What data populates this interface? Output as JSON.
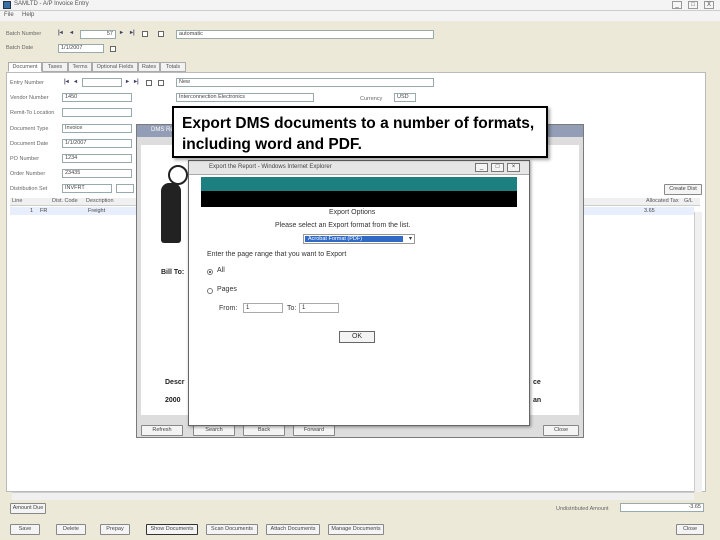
{
  "window": {
    "title": "SAMLTD - A/P Invoice Entry",
    "menu": [
      "File",
      "Help"
    ],
    "controls": [
      "_",
      "□",
      "X"
    ]
  },
  "header": {
    "batch_number_label": "Batch Number",
    "batch_number_value": "57",
    "batch_desc_value": "automatic",
    "batch_date_label": "Batch Date",
    "batch_date_value": "1/1/2007"
  },
  "tabs": [
    "Document",
    "Taxes",
    "Terms",
    "Optional Fields",
    "Rates",
    "Totals"
  ],
  "form": {
    "entry_number_label": "Entry Number",
    "entry_number_value": "",
    "entry_desc_value": "New",
    "vendor_number_label": "Vendor Number",
    "vendor_number_value": "1450",
    "vendor_name_value": "Interconnection Electronics",
    "currency_label": "Currency",
    "currency_value": "USD",
    "remit_to_label": "Remit-To Location",
    "document_type_label": "Document Type",
    "document_type_value": "Invoice",
    "document_date_label": "Document Date",
    "document_date_value": "1/1/2007",
    "po_number_label": "PO Number",
    "po_number_value": "1234",
    "order_number_label": "Order Number",
    "order_number_value": "23435",
    "dist_set_label": "Distribution Set",
    "dist_set_value": "INVFRT"
  },
  "grid": {
    "columns": [
      "Line",
      "Dist. Code",
      "Description",
      "Allocated Tax",
      "G/L"
    ],
    "rows": [
      {
        "line": "1",
        "code": "FR",
        "desc": "Freight",
        "tax": "3.65"
      }
    ],
    "create_dist_label": "Create Dist"
  },
  "viewer": {
    "title": "DMS Report",
    "bill_to": "Bill To:",
    "desc_header": "Descr",
    "desc_value": "2000",
    "right_header": "ce",
    "right_value": "an",
    "buttons": [
      "Refresh",
      "Search",
      "Back",
      "Forward",
      "Close"
    ]
  },
  "dialog": {
    "title": "Export the Report - Windows Internet Explorer",
    "heading": "Export Options",
    "prompt": "Please select an Export format from the list.",
    "format_value": "Acrobat Format (PDF)",
    "range_prompt": "Enter the page range that you want to Export",
    "option_all": "All",
    "option_pages": "Pages",
    "from_label": "From:",
    "from_value": "1",
    "to_label": "To:",
    "to_value": "1",
    "ok_label": "OK"
  },
  "footer": {
    "amount_due_label": "Amount Due",
    "undistributed_label": "Undistributed Amount",
    "undistributed_value": "-3.65",
    "buttons": [
      "Save",
      "Delete",
      "Prepay",
      "Show Documents",
      "Scan Documents",
      "Attach Documents",
      "Manage Documents"
    ],
    "close_label": "Close"
  },
  "callout": {
    "text": "Export DMS documents to a number of formats, including word and PDF."
  }
}
